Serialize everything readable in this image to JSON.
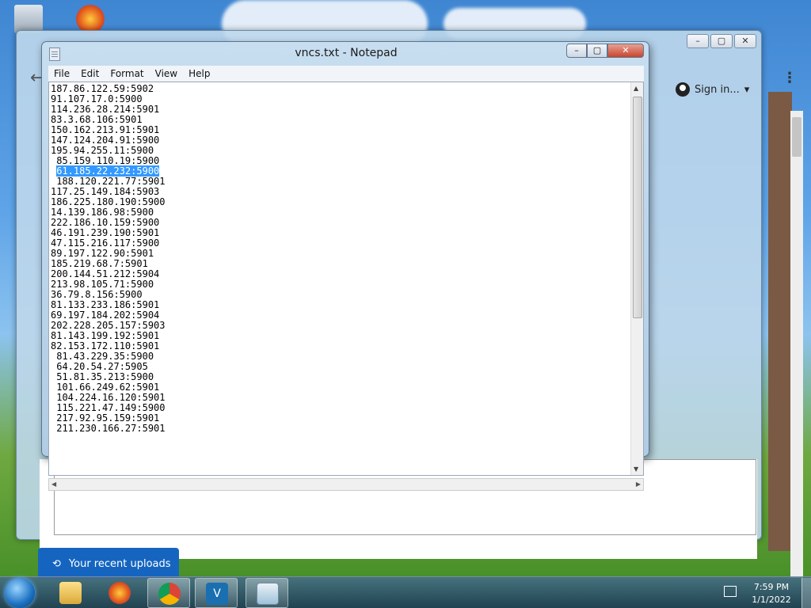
{
  "notepad": {
    "title": "vncs.txt - Notepad",
    "menu": [
      "File",
      "Edit",
      "Format",
      "View",
      "Help"
    ],
    "lines": [
      "187.86.122.59:5902",
      "91.107.17.0:5900",
      "114.236.28.214:5901",
      "83.3.68.106:5901",
      "150.162.213.91:5901",
      "147.124.204.91:5900",
      "195.94.255.11:5900",
      " 85.159.110.19:5900",
      " 61.185.22.232:5900",
      " 188.120.221.77:5901",
      "117.25.149.184:5903",
      "186.225.180.190:5900",
      "14.139.186.98:5900",
      "222.186.10.159:5900",
      "46.191.239.190:5901",
      "47.115.216.117:5900",
      "89.197.122.90:5901",
      "185.219.68.7:5901",
      "200.144.51.212:5904",
      "213.98.105.71:5900",
      "36.79.8.156:5900",
      "81.133.233.186:5901",
      "69.197.184.202:5904",
      "202.228.205.157:5903",
      "81.143.199.192:5901",
      "82.153.172.110:5901",
      " 81.43.229.35:5900",
      " 64.20.54.27:5905",
      " 51.81.35.213:5900",
      " 101.66.249.62:5901",
      " 104.224.16.120:5901",
      " 115.221.47.149:5900",
      " 217.92.95.159:5901",
      " 211.230.166.27:5901"
    ],
    "selected_line_index": 8
  },
  "browser": {
    "sign_in_label": "Sign in...",
    "uploads_label": "Your recent uploads"
  },
  "taskbar": {
    "apps": [
      "file-explorer-icon",
      "firefox-icon",
      "chrome-icon",
      "vnc-viewer-icon",
      "notepad-icon"
    ],
    "time": "7:59 PM",
    "date": "1/1/2022"
  },
  "colors": {
    "selection": "#3399ff",
    "uploads_bg": "#1565c0"
  }
}
